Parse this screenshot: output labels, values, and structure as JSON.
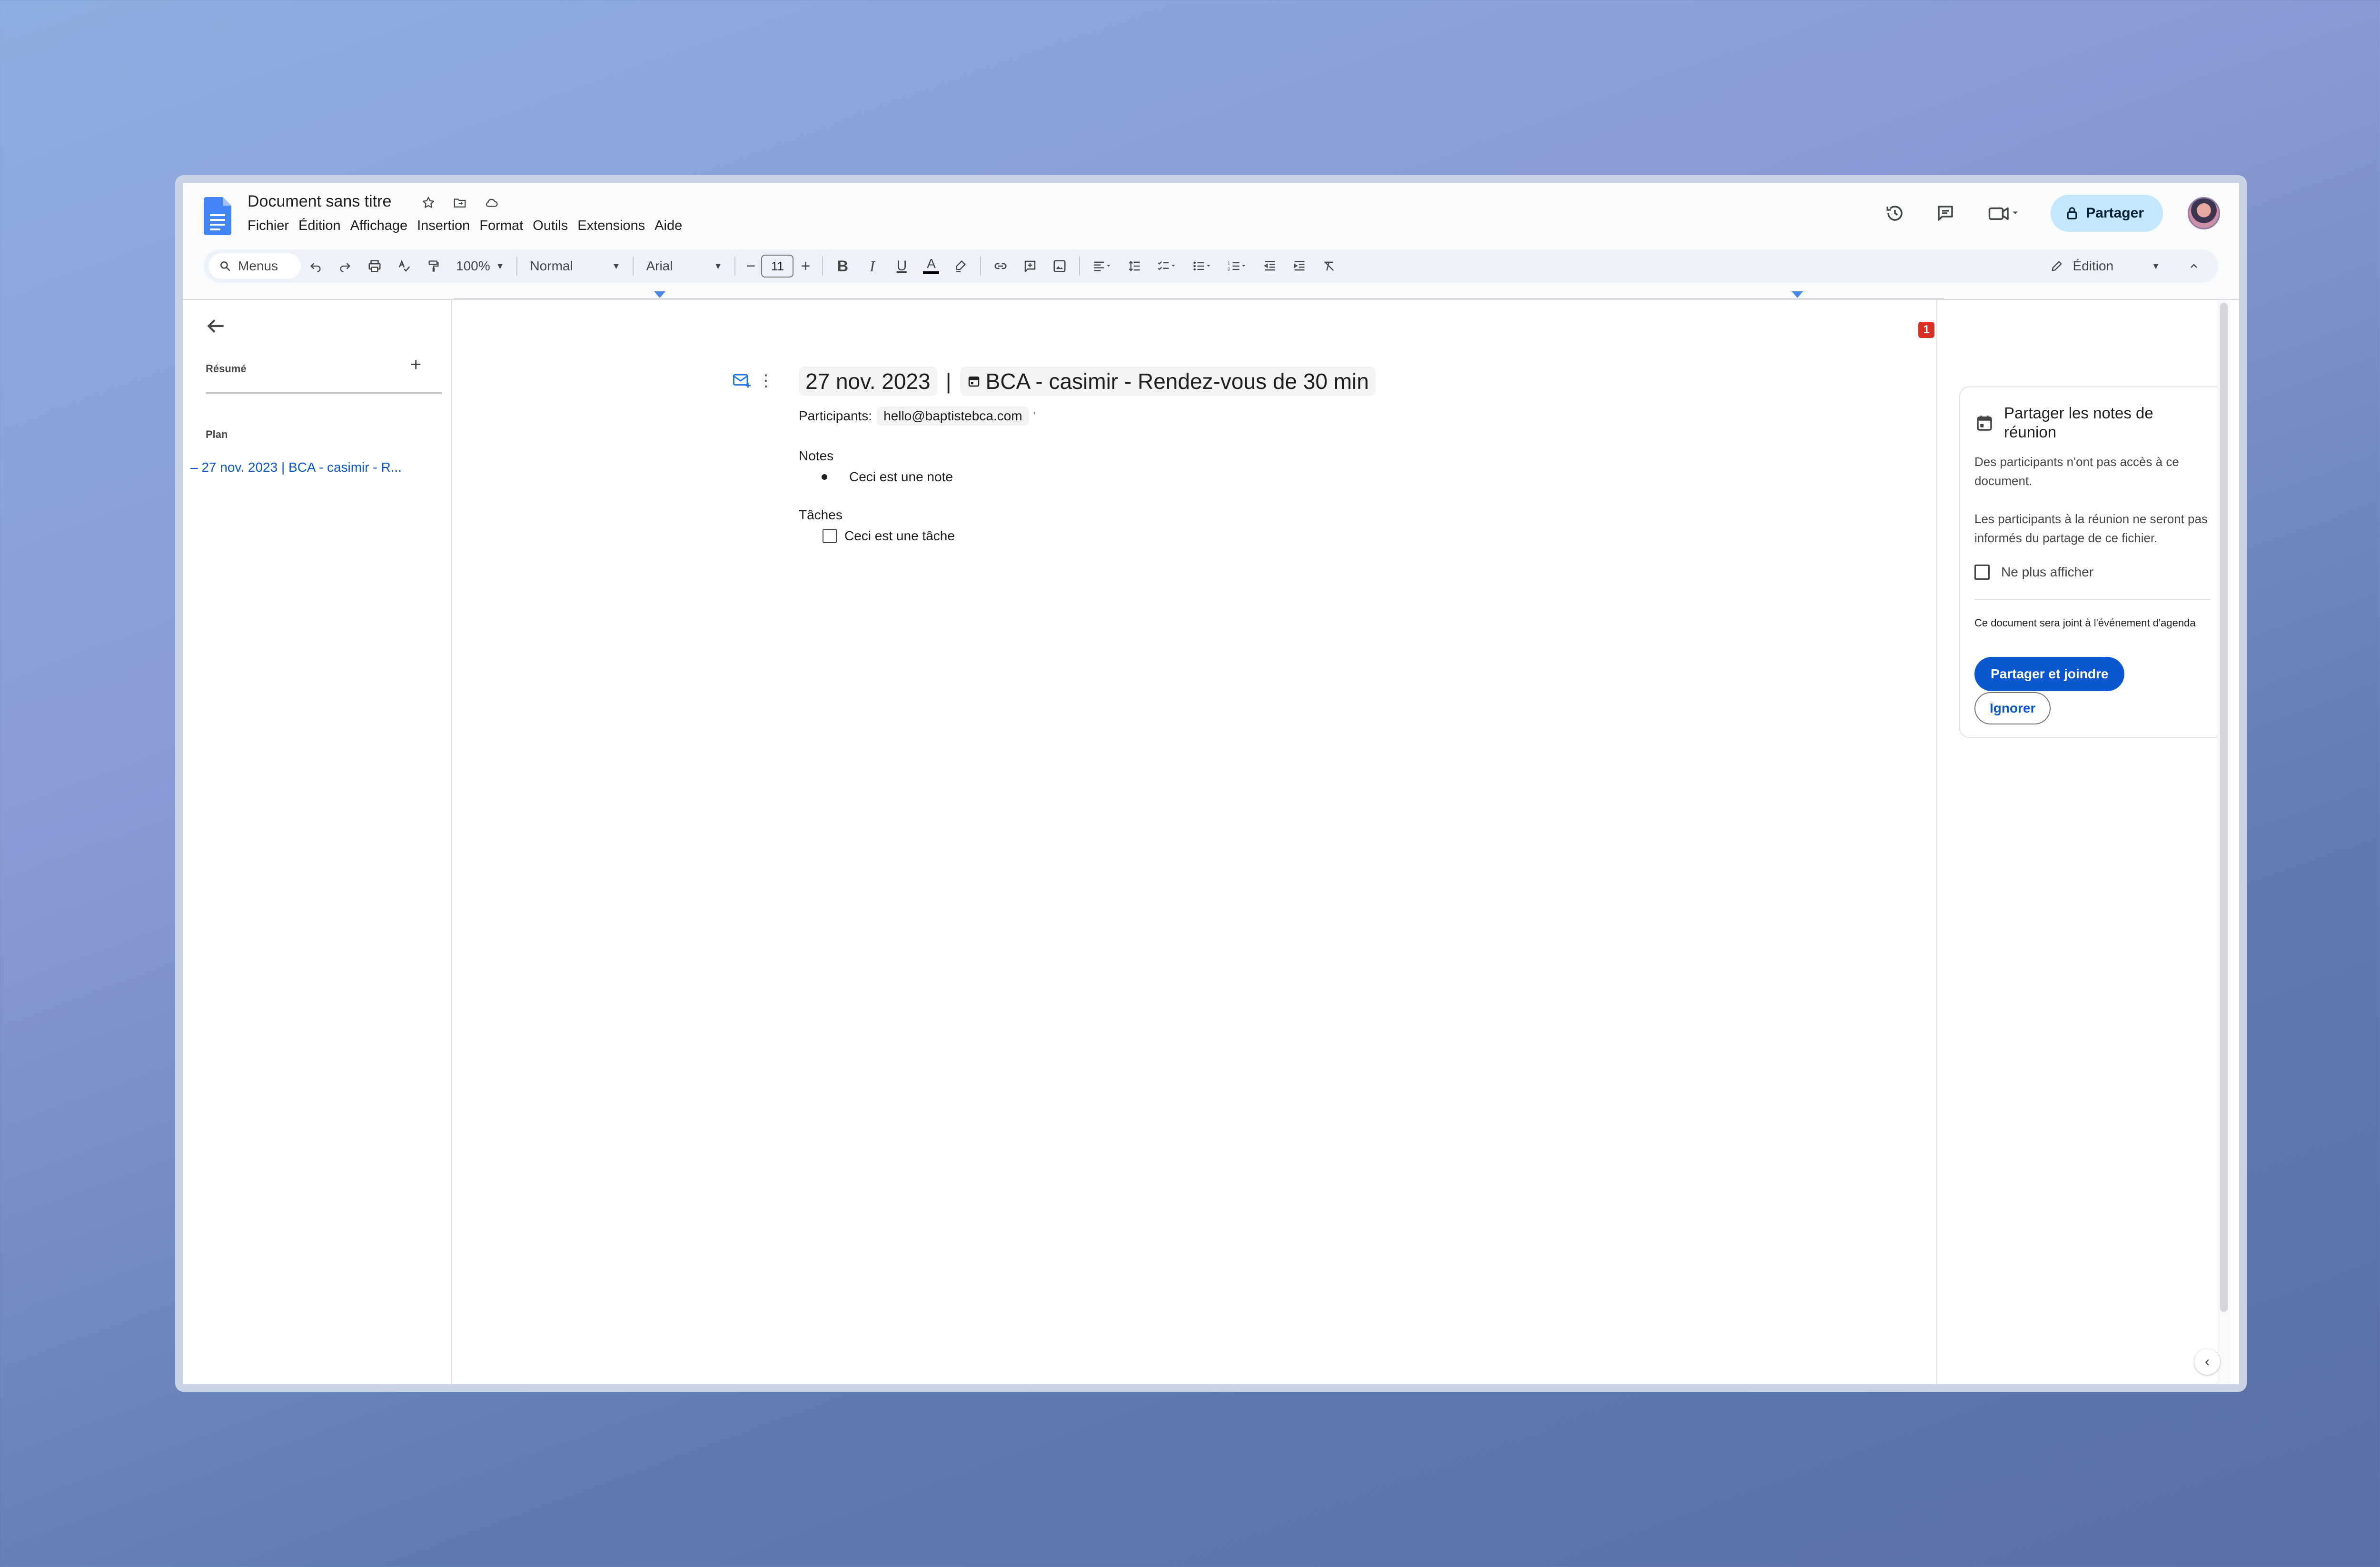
{
  "header": {
    "doc_title": "Document sans titre",
    "menus": [
      "Fichier",
      "Édition",
      "Affichage",
      "Insertion",
      "Format",
      "Outils",
      "Extensions",
      "Aide"
    ],
    "share_label": "Partager"
  },
  "toolbar": {
    "search_placeholder": "Menus",
    "zoom": "100%",
    "style": "Normal",
    "font": "Arial",
    "font_size": "11",
    "mode_label": "Édition"
  },
  "left_pane": {
    "summary_label": "Résumé",
    "plan_label": "Plan",
    "outline_item": "27 nov. 2023 | BCA - casimir - R..."
  },
  "document": {
    "date": "27 nov. 2023",
    "separator": "|",
    "event": "BCA - casimir - Rendez-vous de 30 min",
    "participants_label": "Participants:",
    "participant_email": "hello@baptistebca.com",
    "notes_heading": "Notes",
    "note_item": "Ceci est une note",
    "tasks_heading": "Tâches",
    "task_item": "Ceci est une tâche",
    "comment_badge": "1"
  },
  "share_card": {
    "title": "Partager les notes de réunion",
    "paragraph1": "Des participants n'ont pas accès à ce document.",
    "paragraph2": "Les participants à la réunion ne seront pas informés du partage de ce fichier.",
    "checkbox_label": "Ne plus afficher",
    "note": "Ce document sera joint à l'événement d'agenda",
    "primary_button": "Partager et joindre",
    "secondary_button": "Ignorer"
  },
  "colors": {
    "accent": "#0b57d0",
    "share_bg": "#c2e7ff",
    "toolbar_bg": "#edf2fa",
    "badge": "#d93025"
  }
}
